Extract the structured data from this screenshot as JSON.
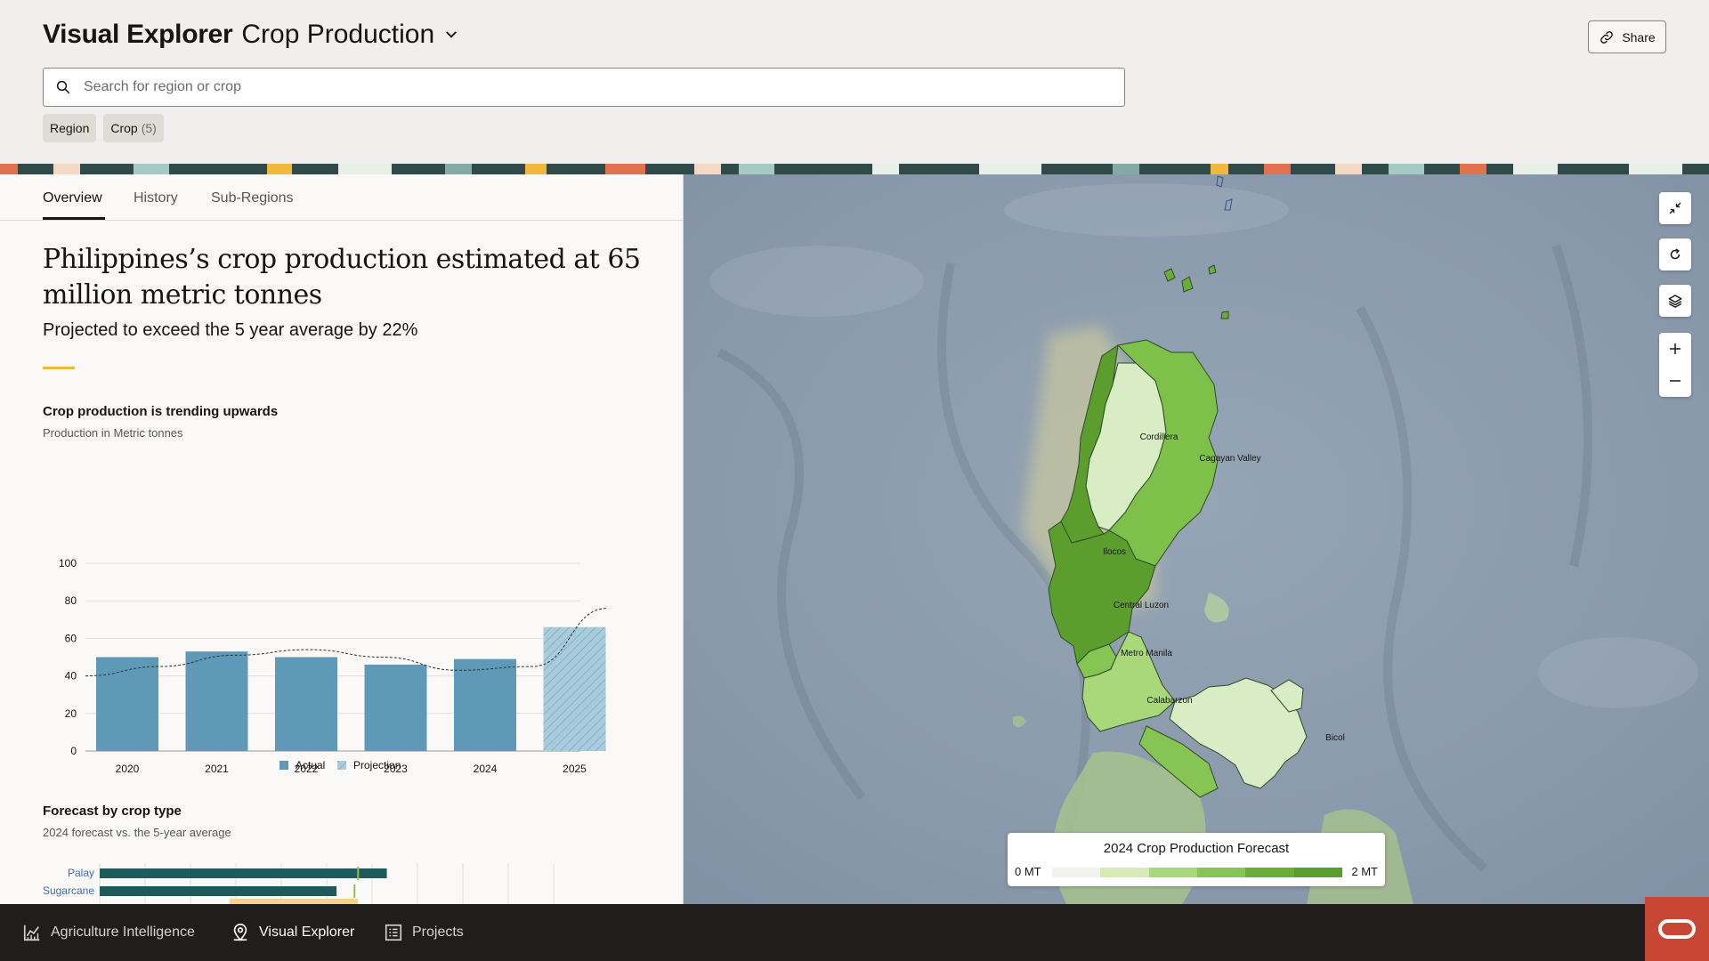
{
  "header": {
    "app_title": "Visual Explorer",
    "dataset": "Crop Production",
    "share_label": "Share",
    "search_placeholder": "Search for region or crop",
    "filters": [
      {
        "label": "Region",
        "count": ""
      },
      {
        "label": "Crop",
        "count": "(5)"
      }
    ]
  },
  "tabs": [
    "Overview",
    "History",
    "Sub-Regions"
  ],
  "active_tab": "Overview",
  "overview": {
    "headline": "Philippines’s crop production estimated at 65 million metric tonnes",
    "subheadline": "Projected to exceed the 5 year average by 22%"
  },
  "production_chart": {
    "title": "Crop production is trending upwards",
    "subtitle": "Production in Metric tonnes"
  },
  "forecast_chart": {
    "title": "Forecast by crop type",
    "subtitle": "2024 forecast vs. the 5-year average"
  },
  "chart_data": [
    {
      "type": "bar",
      "categories": [
        "2020",
        "2021",
        "2022",
        "2023",
        "2024",
        "2025"
      ],
      "values": [
        50,
        53,
        50,
        46,
        49,
        66
      ],
      "bar_kind": [
        "Actual",
        "Actual",
        "Actual",
        "Actual",
        "Actual",
        "Projection"
      ],
      "trend_line": [
        40,
        45,
        51,
        54,
        50,
        43,
        45,
        76
      ],
      "legend": [
        "Actual",
        "Projection"
      ],
      "ylim": [
        0,
        100
      ],
      "yticks": [
        0,
        20,
        40,
        60,
        80,
        100
      ],
      "colors": {
        "actual": "#5e9ab7",
        "projection": "#a9ccdc"
      }
    },
    {
      "type": "bar",
      "orientation": "horizontal",
      "categories": [
        "Palay",
        "Sugarcane"
      ],
      "series": [
        {
          "values": [
            0.8,
            0.66
          ]
        },
        {
          "values": [
            0.72,
            0.71
          ]
        }
      ],
      "colors": {
        "forecast": "#1f5a5a",
        "average": "#8fc24d"
      }
    }
  ],
  "map": {
    "legend_title": "2024 Crop Production Forecast",
    "legend_min": "0 MT",
    "legend_max": "2 MT",
    "legend_colors": [
      "#f1f4ec",
      "#d7ebb9",
      "#a9d87b",
      "#86c453",
      "#6aae38",
      "#5a9e2c"
    ],
    "region_labels": [
      "Cordillera",
      "Cagayan Valley",
      "Ilocos",
      "Central Luzon",
      "Metro Manila",
      "Calabarzon",
      "Bicol"
    ],
    "tool_icons": [
      "collapse-icon",
      "refresh-icon",
      "layers-icon",
      "zoom-in-icon",
      "zoom-out-icon"
    ]
  },
  "bottom_nav": {
    "items": [
      {
        "label": "Agriculture Intelligence",
        "icon": "chart-icon"
      },
      {
        "label": "Visual Explorer",
        "icon": "location-pin-icon"
      },
      {
        "label": "Projects",
        "icon": "list-icon"
      }
    ],
    "active": "Visual Explorer"
  }
}
